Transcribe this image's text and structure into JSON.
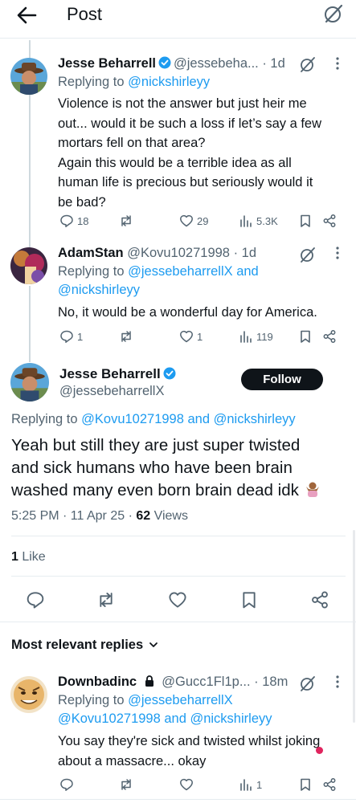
{
  "header": {
    "title": "Post"
  },
  "replies_above": [
    {
      "name": "Jesse Beharrell",
      "handle": "@jessebeha...",
      "time": "· 1d",
      "replying_prefix": "Replying to ",
      "replying_to": "@nickshirleyy",
      "text_lines": [
        "Violence is not the answer but just heir me",
        "out... would it be such a loss if let’s say a few",
        "mortars fell on that area?",
        "Again this would be a terrible idea as all",
        "human life is precious but seriously would it",
        "be bad?"
      ],
      "stats": {
        "replies": "18",
        "reposts": "",
        "likes": "29",
        "views": "5.3K"
      }
    },
    {
      "name": "AdamStan",
      "handle": "@Kovu10271998",
      "time": "· 1d",
      "replying_prefix": "Replying to ",
      "replying_to_line1": "@jessebeharrellX and",
      "replying_to_line2": "@nickshirleyy",
      "text_lines": [
        "No, it would be a wonderful day for America."
      ],
      "stats": {
        "replies": "1",
        "reposts": "",
        "likes": "1",
        "views": "119"
      }
    }
  ],
  "main_post": {
    "name": "Jesse Beharrell",
    "handle": "@jessebeharrellX",
    "follow_label": "Follow",
    "replying_prefix": "Replying to ",
    "replying_to": "@Kovu10271998 and @nickshirleyy",
    "text_lines": [
      "Yeah but still they are just super twisted",
      "and sick humans who have been brain",
      "washed many even born brain dead idk"
    ],
    "timestamp": "5:25 PM · 11 Apr 25 · ",
    "views_count": "62",
    "views_label": " Views",
    "likes_count": "1",
    "likes_label": " Like"
  },
  "sort_label": "Most relevant replies",
  "replies_below": [
    {
      "name": "Downbadinc",
      "handle": "@Gucc1Fl1p...",
      "time": "· 18m",
      "replying_prefix": "Replying to ",
      "replying_to_line1": "@jessebeharrellX",
      "replying_to_line2": "@Kovu10271998 and @nickshirleyy",
      "text_lines": [
        "You say they're sick and twisted whilst joking",
        "about a massacre... okay"
      ],
      "stats": {
        "replies": "",
        "reposts": "",
        "likes": "",
        "views": "1"
      }
    }
  ],
  "colors": {
    "link": "#1d9bf0",
    "verified": "#1d9bf0",
    "muted": "#536471",
    "text": "#0f1419",
    "notification_dot": "#e0245e"
  }
}
